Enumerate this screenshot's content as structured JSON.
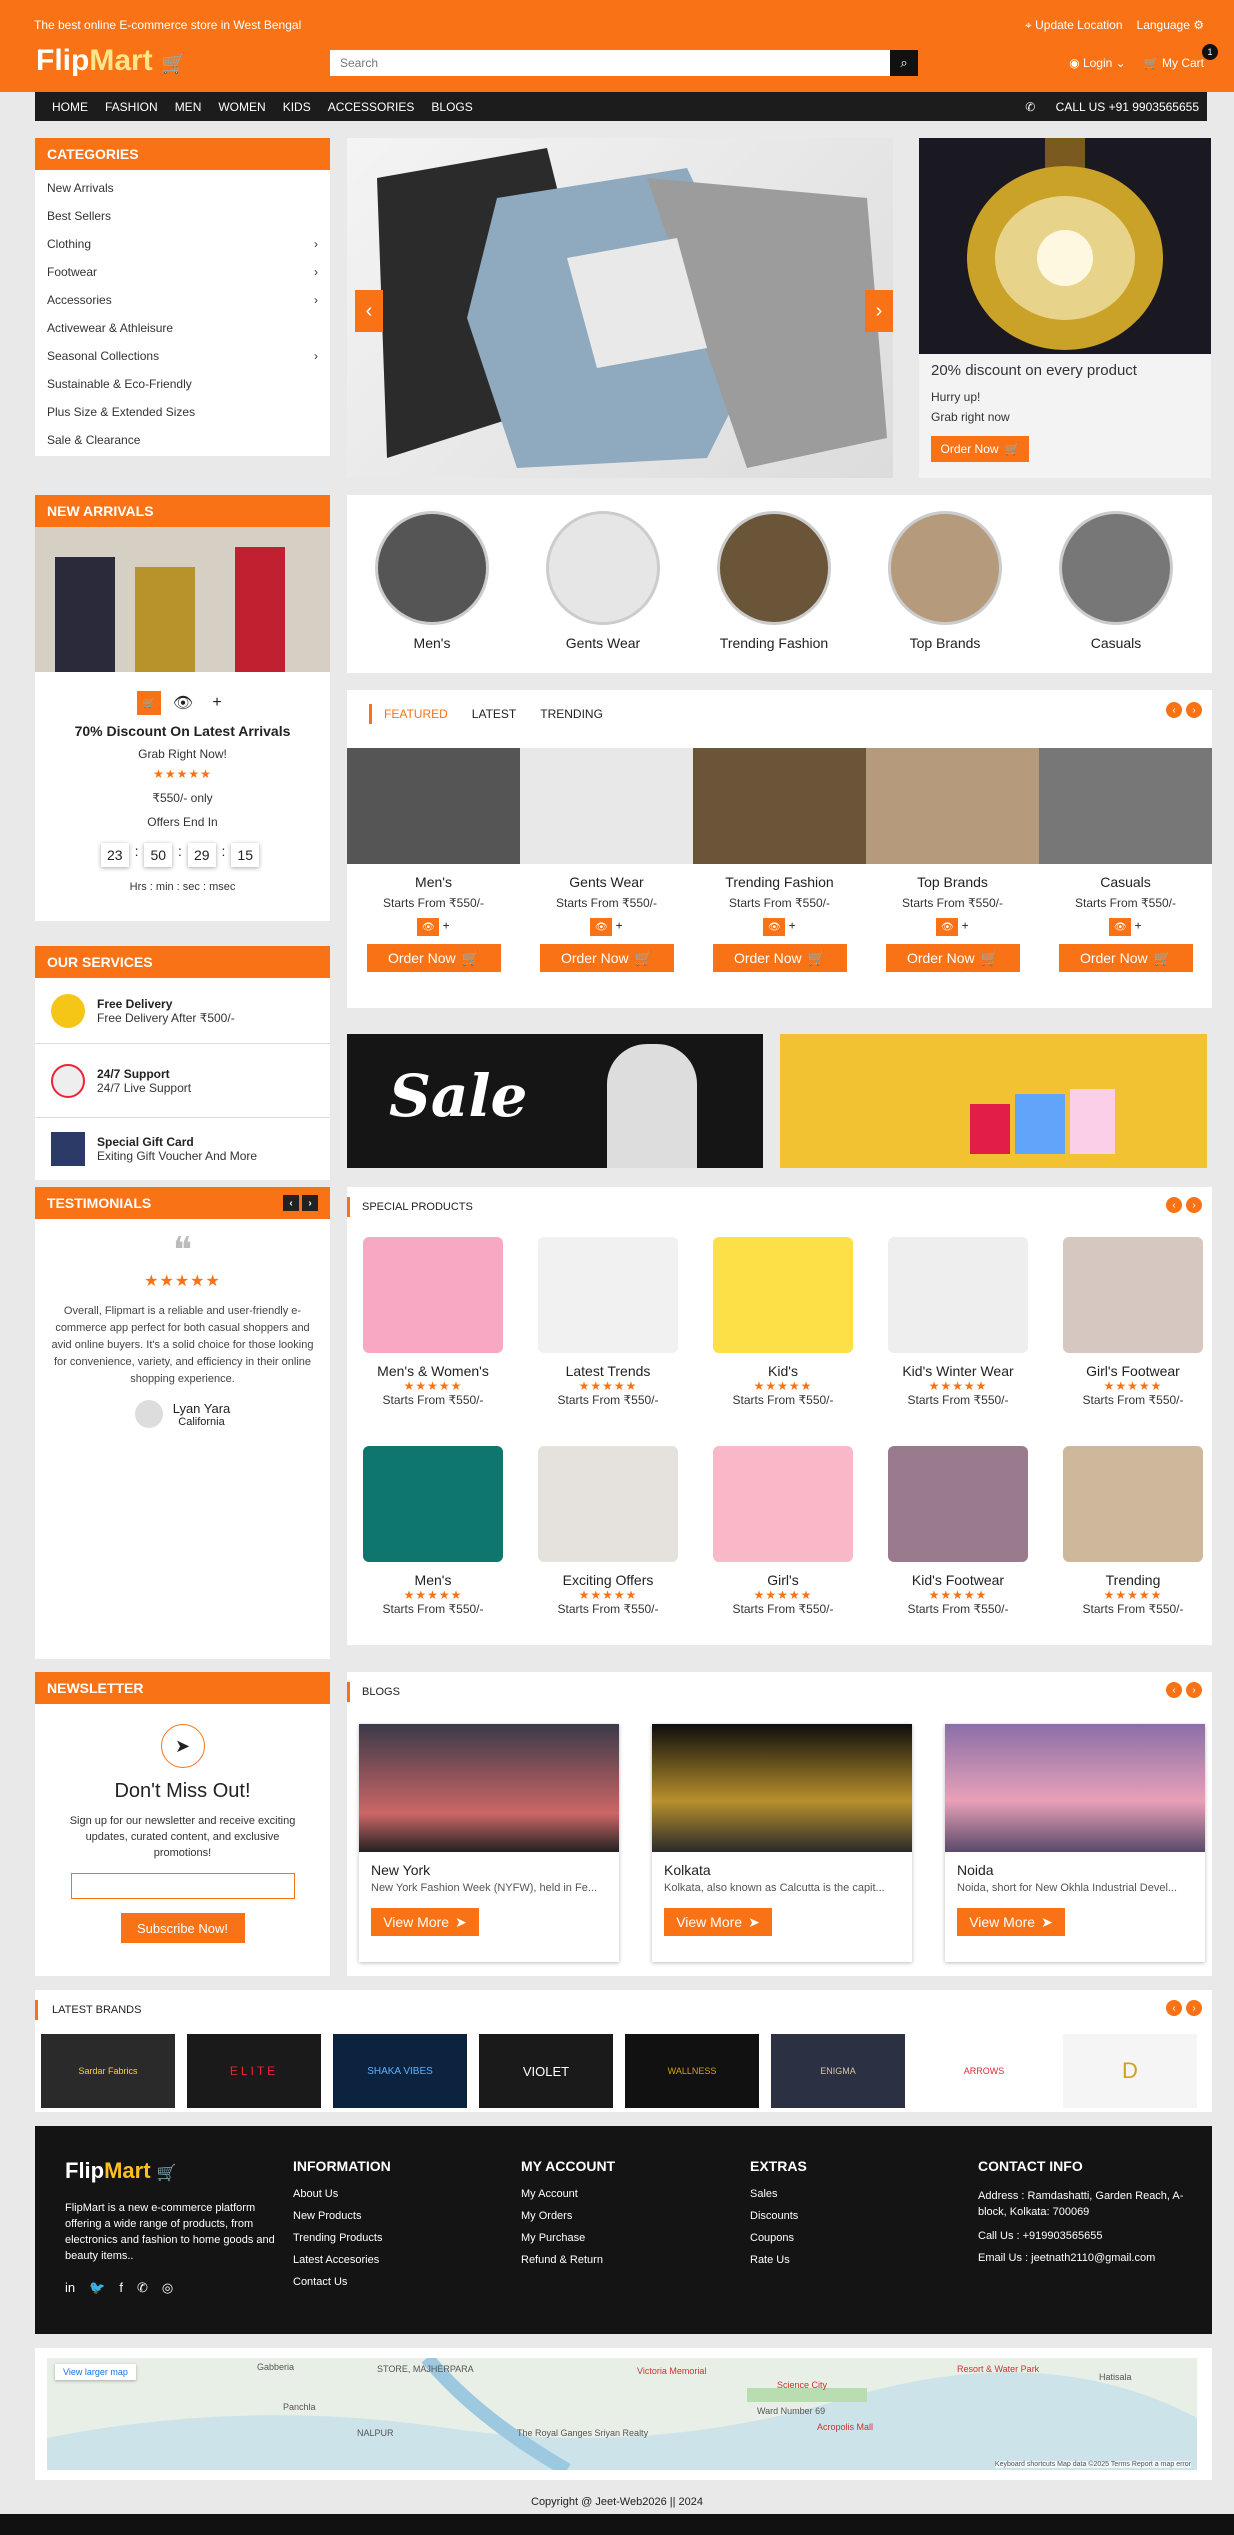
{
  "topbar": {
    "tagline": "The best online E-commerce store in West Bengal",
    "update_location": "Update Location",
    "language": "Language"
  },
  "brand": {
    "flip": "Flip",
    "mart": "Mart"
  },
  "search": {
    "placeholder": "Search"
  },
  "account": {
    "login": "Login",
    "cart": "My Cart",
    "cart_count": "1"
  },
  "nav": {
    "items": [
      "HOME",
      "FASHION",
      "MEN",
      "WOMEN",
      "KIDS",
      "ACCESSORIES",
      "BLOGS"
    ],
    "call": "CALL US +91 9903565655"
  },
  "categories": {
    "title": "CATEGORIES",
    "items": [
      "New Arrivals",
      "Best Sellers",
      "Clothing",
      "Footwear",
      "Accessories",
      "Activewear & Athleisure",
      "Seasonal Collections",
      "Sustainable & Eco-Friendly",
      "Plus Size & Extended Sizes",
      "Sale & Clearance"
    ]
  },
  "promo": {
    "headline": "20% discount on every product",
    "sub1": "Hurry up!",
    "sub2": "Grab right now",
    "cta": "Order Now"
  },
  "new_arrivals": {
    "title": "NEW ARRIVALS",
    "heading": "70% Discount On Latest Arrivals",
    "grab": "Grab Right Now!",
    "price": "₹550/- only",
    "offers": "Offers End In",
    "timer": [
      "23",
      "50",
      "29",
      "15"
    ],
    "units": "Hrs : min : sec : msec"
  },
  "circles": [
    "Men's",
    "Gents Wear",
    "Trending Fashion",
    "Top Brands",
    "Casuals"
  ],
  "tabs": {
    "items": [
      "FEATURED",
      "LATEST",
      "TRENDING"
    ]
  },
  "featured": {
    "items": [
      "Men's",
      "Gents Wear",
      "Trending Fashion",
      "Top Brands",
      "Casuals"
    ],
    "price": "Starts From ₹550/-",
    "cta": "Order Now"
  },
  "services": {
    "title": "OUR SERVICES",
    "items": [
      {
        "t": "Free Delivery",
        "s": "Free Delivery After ₹500/-"
      },
      {
        "t": "24/7 Support",
        "s": "24/7 Live Support"
      },
      {
        "t": "Special Gift Card",
        "s": "Exiting Gift Voucher And More"
      }
    ]
  },
  "sale": {
    "text": "Sale"
  },
  "testimonials": {
    "title": "TESTIMONIALS",
    "quote": "Overall, Flipmart is a reliable and user-friendly e-commerce app perfect for both casual shoppers and avid online buyers. It's a solid choice for those looking for convenience, variety, and efficiency in their online shopping experience.",
    "name": "Lyan Yara",
    "place": "California"
  },
  "special": {
    "title": "SPECIAL PRODUCTS",
    "price": "Starts From ₹550/-",
    "row1": [
      "Men's & Women's",
      "Latest Trends",
      "Kid's",
      "Kid's Winter Wear",
      "Girl's Footwear"
    ],
    "row2": [
      "Men's",
      "Exciting Offers",
      "Girl's",
      "Kid's Footwear",
      "Trending"
    ]
  },
  "newsletter": {
    "title": "NEWSLETTER",
    "heading": "Don't Miss Out!",
    "text": "Sign up for our newsletter and receive exciting updates, curated content, and exclusive promotions!",
    "cta": "Subscribe Now!"
  },
  "blogs": {
    "title": "BLOGS",
    "cta": "View More",
    "items": [
      {
        "city": "New York",
        "desc": "New York Fashion Week (NYFW), held in Fe..."
      },
      {
        "city": "Kolkata",
        "desc": "Kolkata, also known as Calcutta is the capit..."
      },
      {
        "city": "Noida",
        "desc": "Noida, short for New Okhla Industrial Devel..."
      }
    ]
  },
  "brands": {
    "title": "LATEST BRANDS",
    "items": [
      "Sardar Fabrics",
      "ELITE",
      "SHAKA VIBES",
      "VIOLET",
      "WALLNESS",
      "ENIGMA",
      "ARROWS",
      "D"
    ]
  },
  "footer": {
    "about": "FlipMart is a new e-commerce platform offering a wide range of products, from electronics and fashion to home goods and beauty items..",
    "info": {
      "title": "INFORMATION",
      "items": [
        "About Us",
        "New Products",
        "Trending Products",
        "Latest Accesories",
        "Contact Us"
      ]
    },
    "account": {
      "title": "MY ACCOUNT",
      "items": [
        "My Account",
        "My Orders",
        "My Purchase",
        "Refund & Return"
      ]
    },
    "extras": {
      "title": "EXTRAS",
      "items": [
        "Sales",
        "Discounts",
        "Coupons",
        "Rate Us"
      ]
    },
    "contact": {
      "title": "CONTACT INFO",
      "address": "Address : Ramdashatti, Garden Reach, A-block, Kolkata: 700069",
      "call": "Call Us : +919903565655",
      "email": "Email Us : jeetnath2110@gmail.com"
    }
  },
  "map": {
    "link": "View larger map",
    "labels": [
      "Gabberia",
      "STORE, MAJHERPARA",
      "Victoria Memorial",
      "Science City",
      "Resort & Water Park",
      "Hatisala",
      "Panchla",
      "NALPUR",
      "The Royal Ganges Sriyan Realty",
      "Ward Number 69",
      "Acropolis Mall"
    ],
    "footnote": "Keyboard shortcuts   Map data ©2025   Terms   Report a map error"
  },
  "copyright": "Copyright @ Jeet-Web2026 || 2024",
  "colors": {
    "accent": "#f97316",
    "dark": "#1c1c1c"
  }
}
